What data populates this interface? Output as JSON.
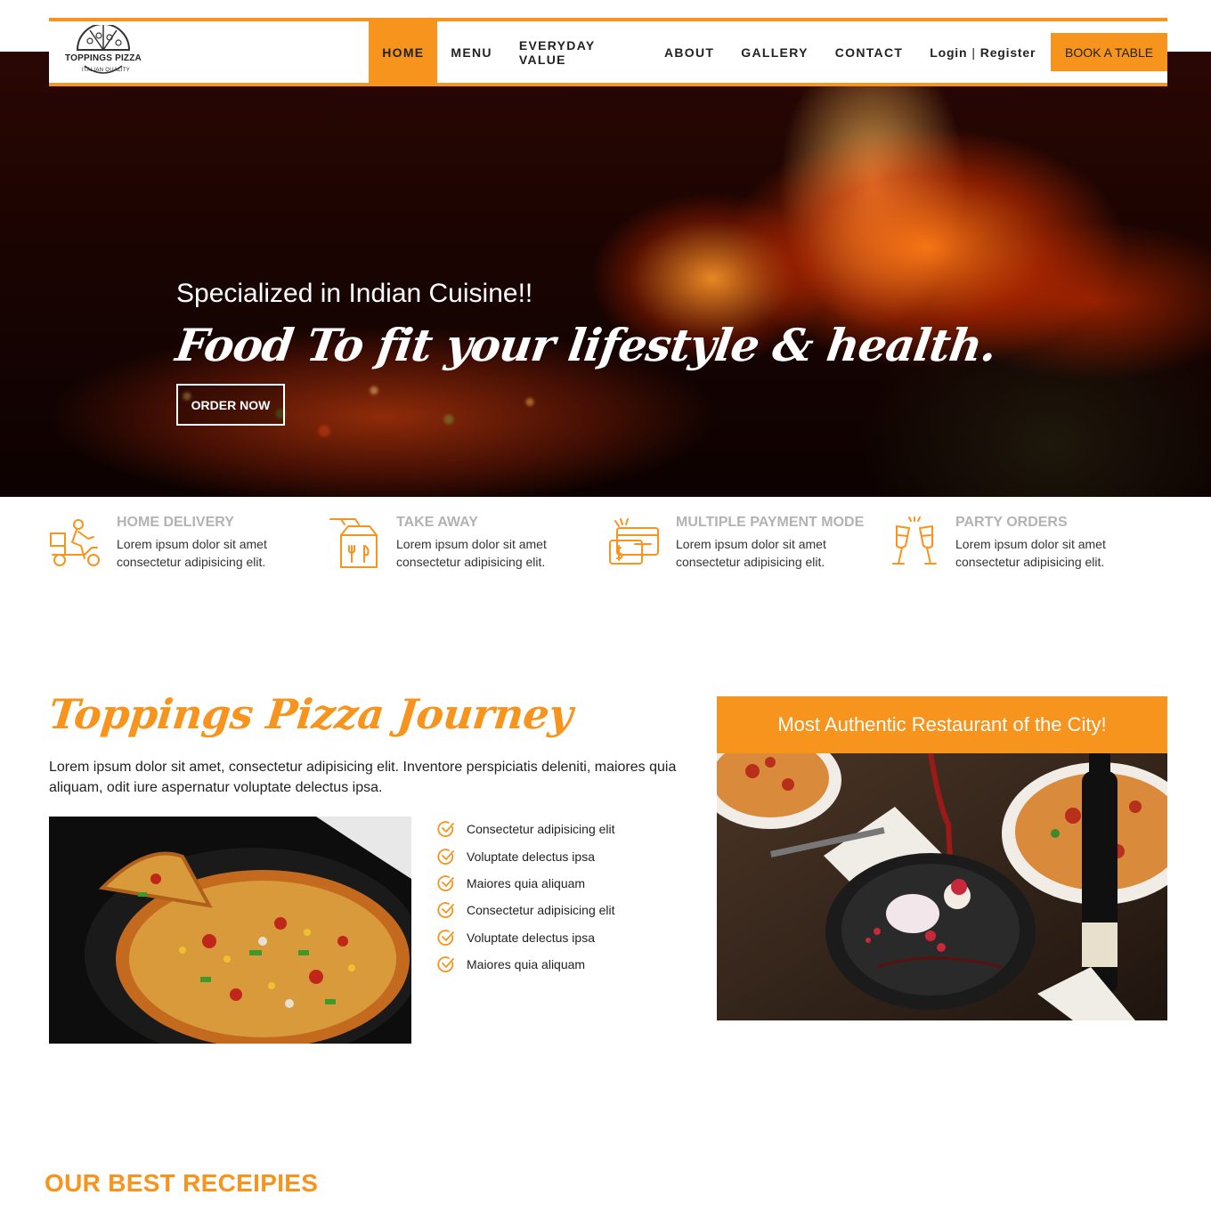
{
  "brand": {
    "name": "TOPPINGS PIZZA",
    "tagline": "ITALIAN QUALITY"
  },
  "nav": {
    "items": [
      {
        "label": "HOME",
        "active": true
      },
      {
        "label": "MENU",
        "active": false
      },
      {
        "label": "EVERYDAY VALUE",
        "active": false
      },
      {
        "label": "ABOUT",
        "active": false
      },
      {
        "label": "GALLERY",
        "active": false
      },
      {
        "label": "CONTACT",
        "active": false
      }
    ],
    "login": "Login",
    "separator": "|",
    "register": "Register",
    "book_label": "BOOK A TABLE"
  },
  "hero": {
    "subtitle": "Specialized in Indian Cuisine!!",
    "title": "Food To fit your lifestyle & health.",
    "cta": "ORDER NOW"
  },
  "features": [
    {
      "icon": "delivery-scooter-icon",
      "title": "HOME DELIVERY",
      "text": "Lorem ipsum dolor sit amet consectetur adipisicing elit."
    },
    {
      "icon": "takeaway-bag-icon",
      "title": "TAKE AWAY",
      "text": "Lorem ipsum dolor sit amet consectetur adipisicing elit."
    },
    {
      "icon": "payment-card-icon",
      "title": "MULTIPLE PAYMENT MODE",
      "text": "Lorem ipsum dolor sit amet consectetur adipisicing elit."
    },
    {
      "icon": "champagne-glasses-icon",
      "title": "PARTY ORDERS",
      "text": "Lorem ipsum dolor sit amet consectetur adipisicing elit."
    }
  ],
  "journey": {
    "title": "Toppings Pizza Journey",
    "text": "Lorem ipsum dolor sit amet, consectetur adipisicing elit. Inventore perspiciatis deleniti, maiores quia aliquam, odit iure aspernatur voluptate delectus ipsa.",
    "checklist": [
      "Consectetur adipisicing elit",
      "Voluptate delectus ipsa",
      "Maiores quia aliquam",
      "Consectetur adipisicing elit",
      "Voluptate delectus ipsa",
      "Maiores quia aliquam"
    ]
  },
  "card": {
    "title": "Most Authentic Restaurant of the City!"
  },
  "recipes": {
    "title": "OUR BEST RECEIPIES"
  },
  "colors": {
    "accent": "#f7941d",
    "muted_title": "#b3b3b3"
  }
}
